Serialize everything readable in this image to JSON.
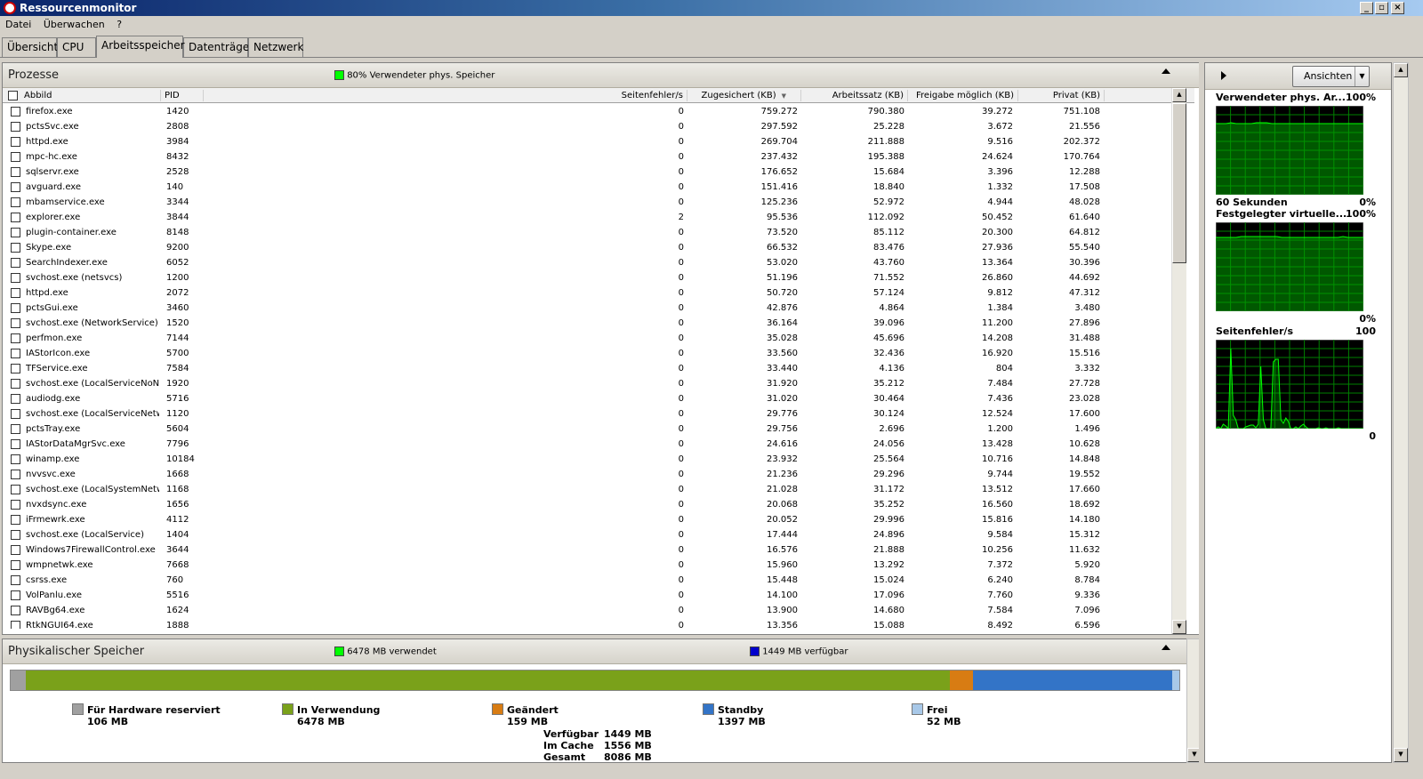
{
  "window": {
    "title": "Ressourcenmonitor"
  },
  "menu": [
    "Datei",
    "Überwachen",
    "?"
  ],
  "tabs": [
    "Übersicht",
    "CPU",
    "Arbeitsspeicher",
    "Datenträger",
    "Netzwerk"
  ],
  "active_tab": "Arbeitsspeicher",
  "processes": {
    "title": "Prozesse",
    "legend": "80% Verwendeter phys. Speicher",
    "legend_color": "#00ff00",
    "columns": [
      "Abbild",
      "PID",
      "Seitenfehler/s",
      "Zugesichert (KB)",
      "Arbeitssatz (KB)",
      "Freigabe möglich (KB)",
      "Privat (KB)"
    ],
    "sort_indicator": "▼",
    "rows": [
      [
        "firefox.exe",
        "1420",
        "0",
        "759.272",
        "790.380",
        "39.272",
        "751.108"
      ],
      [
        "pctsSvc.exe",
        "2808",
        "0",
        "297.592",
        "25.228",
        "3.672",
        "21.556"
      ],
      [
        "httpd.exe",
        "3984",
        "0",
        "269.704",
        "211.888",
        "9.516",
        "202.372"
      ],
      [
        "mpc-hc.exe",
        "8432",
        "0",
        "237.432",
        "195.388",
        "24.624",
        "170.764"
      ],
      [
        "sqlservr.exe",
        "2528",
        "0",
        "176.652",
        "15.684",
        "3.396",
        "12.288"
      ],
      [
        "avguard.exe",
        "140",
        "0",
        "151.416",
        "18.840",
        "1.332",
        "17.508"
      ],
      [
        "mbamservice.exe",
        "3344",
        "0",
        "125.236",
        "52.972",
        "4.944",
        "48.028"
      ],
      [
        "explorer.exe",
        "3844",
        "2",
        "95.536",
        "112.092",
        "50.452",
        "61.640"
      ],
      [
        "plugin-container.exe",
        "8148",
        "0",
        "73.520",
        "85.112",
        "20.300",
        "64.812"
      ],
      [
        "Skype.exe",
        "9200",
        "0",
        "66.532",
        "83.476",
        "27.936",
        "55.540"
      ],
      [
        "SearchIndexer.exe",
        "6052",
        "0",
        "53.020",
        "43.760",
        "13.364",
        "30.396"
      ],
      [
        "svchost.exe (netsvcs)",
        "1200",
        "0",
        "51.196",
        "71.552",
        "26.860",
        "44.692"
      ],
      [
        "httpd.exe",
        "2072",
        "0",
        "50.720",
        "57.124",
        "9.812",
        "47.312"
      ],
      [
        "pctsGui.exe",
        "3460",
        "0",
        "42.876",
        "4.864",
        "1.384",
        "3.480"
      ],
      [
        "svchost.exe (NetworkService)",
        "1520",
        "0",
        "36.164",
        "39.096",
        "11.200",
        "27.896"
      ],
      [
        "perfmon.exe",
        "7144",
        "0",
        "35.028",
        "45.696",
        "14.208",
        "31.488"
      ],
      [
        "IAStorIcon.exe",
        "5700",
        "0",
        "33.560",
        "32.436",
        "16.920",
        "15.516"
      ],
      [
        "TFService.exe",
        "7584",
        "0",
        "33.440",
        "4.136",
        "804",
        "3.332"
      ],
      [
        "svchost.exe (LocalServiceNoNet...",
        "1920",
        "0",
        "31.920",
        "35.212",
        "7.484",
        "27.728"
      ],
      [
        "audiodg.exe",
        "5716",
        "0",
        "31.020",
        "30.464",
        "7.436",
        "23.028"
      ],
      [
        "svchost.exe (LocalServiceNetwo...",
        "1120",
        "0",
        "29.776",
        "30.124",
        "12.524",
        "17.600"
      ],
      [
        "pctsTray.exe",
        "5604",
        "0",
        "29.756",
        "2.696",
        "1.200",
        "1.496"
      ],
      [
        "IAStorDataMgrSvc.exe",
        "7796",
        "0",
        "24.616",
        "24.056",
        "13.428",
        "10.628"
      ],
      [
        "winamp.exe",
        "10184",
        "0",
        "23.932",
        "25.564",
        "10.716",
        "14.848"
      ],
      [
        "nvvsvc.exe",
        "1668",
        "0",
        "21.236",
        "29.296",
        "9.744",
        "19.552"
      ],
      [
        "svchost.exe (LocalSystemNetwo...",
        "1168",
        "0",
        "21.028",
        "31.172",
        "13.512",
        "17.660"
      ],
      [
        "nvxdsync.exe",
        "1656",
        "0",
        "20.068",
        "35.252",
        "16.560",
        "18.692"
      ],
      [
        "iFrmewrk.exe",
        "4112",
        "0",
        "20.052",
        "29.996",
        "15.816",
        "14.180"
      ],
      [
        "svchost.exe (LocalService)",
        "1404",
        "0",
        "17.444",
        "24.896",
        "9.584",
        "15.312"
      ],
      [
        "Windows7FirewallControl.exe",
        "3644",
        "0",
        "16.576",
        "21.888",
        "10.256",
        "11.632"
      ],
      [
        "wmpnetwk.exe",
        "7668",
        "0",
        "15.960",
        "13.292",
        "7.372",
        "5.920"
      ],
      [
        "csrss.exe",
        "760",
        "0",
        "15.448",
        "15.024",
        "6.240",
        "8.784"
      ],
      [
        "VolPanlu.exe",
        "5516",
        "0",
        "14.100",
        "17.096",
        "7.760",
        "9.336"
      ],
      [
        "RAVBg64.exe",
        "1624",
        "0",
        "13.900",
        "14.680",
        "7.584",
        "7.096"
      ],
      [
        "RtkNGUI64.exe",
        "1888",
        "0",
        "13.356",
        "15.088",
        "8.492",
        "6.596"
      ]
    ]
  },
  "physical": {
    "title": "Physikalischer Speicher",
    "used_label": "6478 MB verwendet",
    "used_color": "#00ff00",
    "avail_label": "1449 MB verfügbar",
    "avail_color": "#0000cc",
    "segments": [
      {
        "name": "Für Hardware reserviert",
        "value": "106 MB",
        "mb": 106,
        "color": "#a0a0a0"
      },
      {
        "name": "In Verwendung",
        "value": "6478 MB",
        "mb": 6478,
        "color": "#7aa11a"
      },
      {
        "name": "Geändert",
        "value": "159 MB",
        "mb": 159,
        "color": "#d87c13"
      },
      {
        "name": "Standby",
        "value": "1397 MB",
        "mb": 1397,
        "color": "#3374c7"
      },
      {
        "name": "Frei",
        "value": "52 MB",
        "mb": 52,
        "color": "#a8c8e8"
      }
    ],
    "stats": [
      {
        "label": "Verfügbar",
        "value": "1449 MB"
      },
      {
        "label": "Im Cache",
        "value": "1556 MB"
      },
      {
        "label": "Gesamt",
        "value": "8086 MB"
      }
    ]
  },
  "sidepanel": {
    "view_button": "Ansichten",
    "graphs": [
      {
        "title": "Verwendeter phys. Ar...",
        "top_pct": "100%",
        "bottom_label": "60 Sekunden",
        "bottom_pct": "0%",
        "series": [
          80,
          80,
          80,
          81,
          80,
          80,
          80,
          80,
          81,
          81,
          81,
          80,
          80,
          80,
          80,
          80,
          80,
          80,
          80,
          80,
          80,
          80,
          80,
          80,
          80,
          80,
          80,
          80,
          80,
          80
        ]
      },
      {
        "title": "Festgelegter virtuelle...",
        "top_pct": "100%",
        "bottom_label": "",
        "bottom_pct": "0%",
        "series": [
          83,
          83,
          83,
          83,
          83,
          84,
          84,
          84,
          84,
          84,
          84,
          84,
          84,
          83,
          83,
          83,
          83,
          83,
          83,
          83,
          83,
          83,
          83,
          83,
          83,
          84,
          83,
          83,
          83,
          83
        ]
      },
      {
        "title": "Seitenfehler/s",
        "top_pct": "100",
        "bottom_label": "",
        "bottom_pct": "0",
        "series": [
          0,
          2,
          0,
          5,
          3,
          0,
          90,
          15,
          10,
          0,
          0,
          0,
          2,
          3,
          4,
          4,
          1,
          5,
          70,
          10,
          0,
          0,
          0,
          75,
          78,
          78,
          10,
          6,
          12,
          8,
          0,
          0,
          2,
          0,
          3,
          5,
          2,
          0,
          0,
          0,
          0,
          1,
          0,
          0,
          1,
          0,
          0,
          0,
          0,
          1,
          0,
          0,
          0,
          0,
          0,
          0,
          0,
          0,
          0,
          0
        ]
      }
    ]
  }
}
